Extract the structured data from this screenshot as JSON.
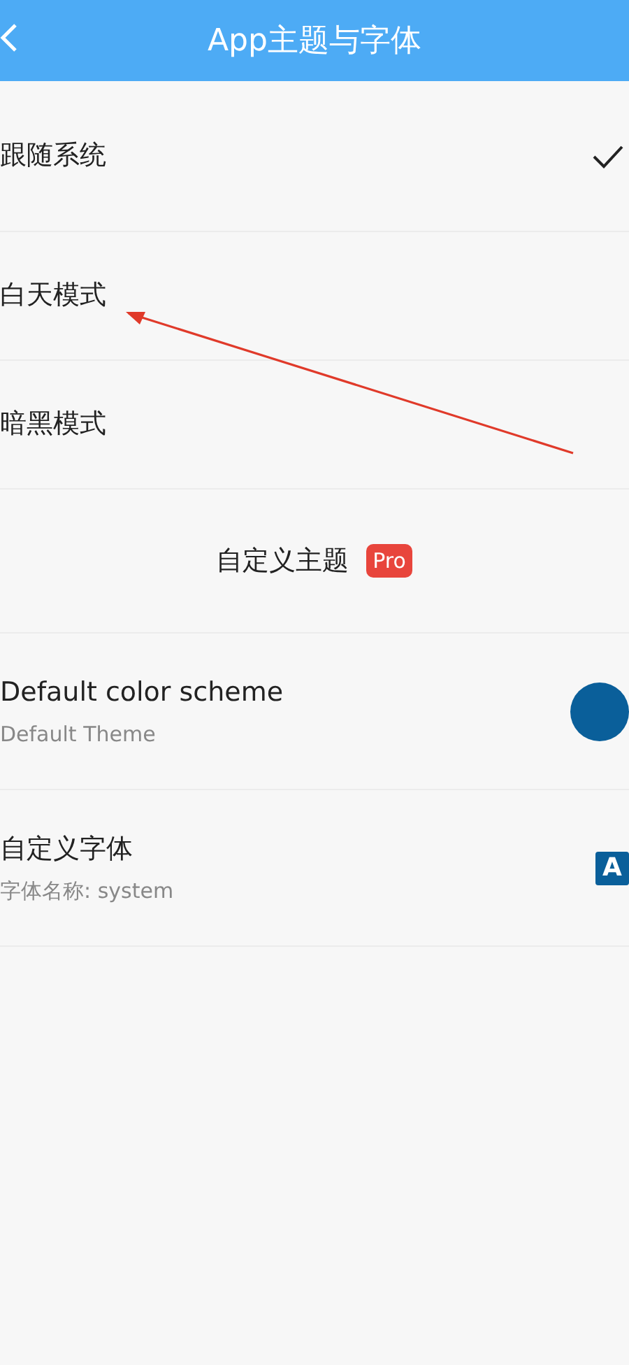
{
  "header": {
    "title": "App主题与字体"
  },
  "theme_modes": [
    {
      "label": "跟随系统",
      "selected": true
    },
    {
      "label": "白天模式",
      "selected": false
    },
    {
      "label": "暗黑模式",
      "selected": false
    }
  ],
  "custom_theme": {
    "label": "自定义主题",
    "badge": "Pro"
  },
  "settings": [
    {
      "kind": "color",
      "title": "Default color scheme",
      "subtitle": "Default Theme",
      "color": "#0a5f9a"
    },
    {
      "kind": "font",
      "title": "自定义字体",
      "subtitle": "字体名称: system",
      "icon_text": "A"
    }
  ]
}
